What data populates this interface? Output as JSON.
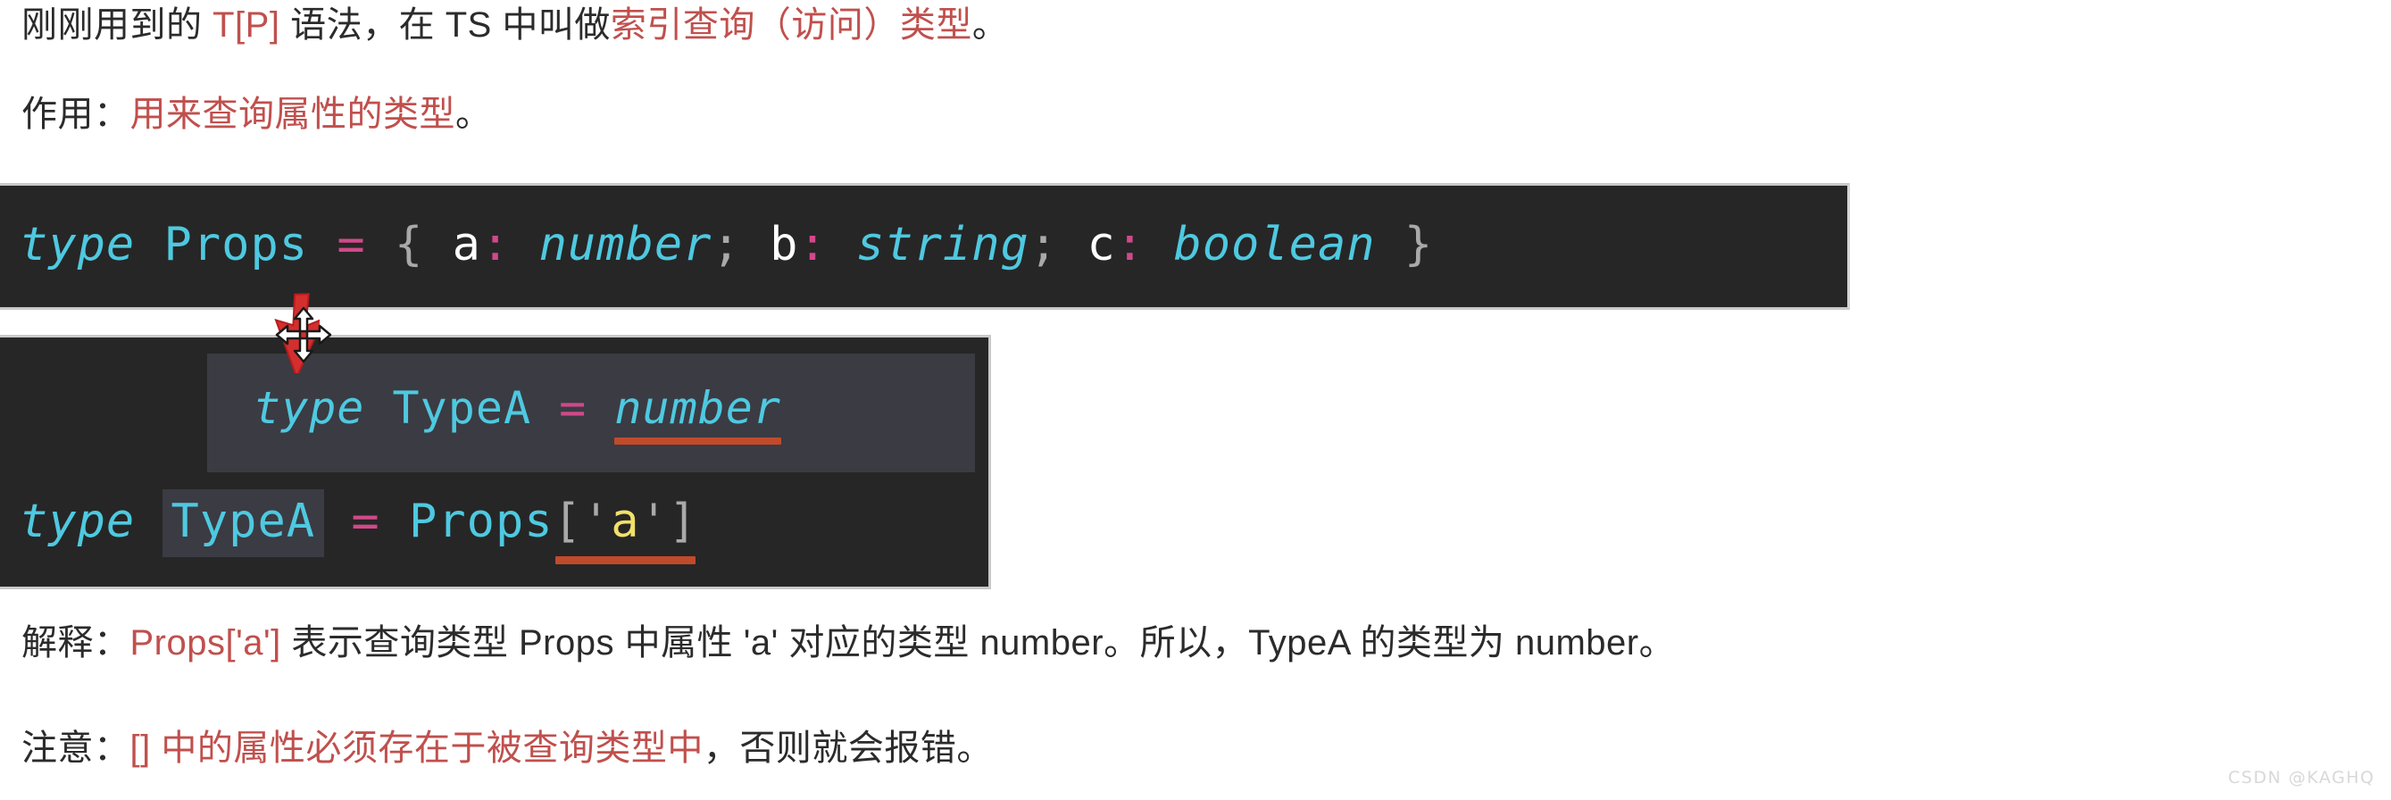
{
  "paragraphs": {
    "intro": {
      "lead": "刚刚用到的 ",
      "code": "T[P]",
      "mid": " 语法，在 TS 中叫做",
      "highlight": "索引查询（访问）类型",
      "tail": "。"
    },
    "usage": {
      "lead": "作用：",
      "highlight": "用来查询属性的类型",
      "tail": "。"
    },
    "explain": {
      "lead": "解释：",
      "highlight": "Props['a']",
      "tail": " 表示查询类型 Props 中属性 'a' 对应的类型 number。所以，TypeA 的类型为 number。"
    },
    "note": {
      "lead": "注意：",
      "highlight": "[] 中的属性必须存在于被查询类型中",
      "tail": "，否则就会报错。"
    }
  },
  "code_block_props": {
    "tokens": {
      "kw_type": "type",
      "space1": " ",
      "name_props": "Props",
      "space2": " ",
      "eq": "=",
      "space3": " ",
      "brace_open": "{",
      "space4": " ",
      "prop_a": "a",
      "colon_a": ":",
      "space5": " ",
      "type_number": "number",
      "semi1": ";",
      "space6": " ",
      "prop_b": "b",
      "colon_b": ":",
      "space7": " ",
      "type_string": "string",
      "semi2": ";",
      "space8": " ",
      "prop_c": "c",
      "colon_c": ":",
      "space9": " ",
      "type_boolean": "boolean",
      "space10": " ",
      "brace_close": "}"
    }
  },
  "code_block_typea": {
    "tooltip": {
      "kw_type": "type",
      "space1": " ",
      "name": "TypeA",
      "space2": " ",
      "eq": "=",
      "space3": " ",
      "resolved_type": "number"
    },
    "line": {
      "kw_type": "type",
      "space1": " ",
      "name": "TypeA",
      "space2": " ",
      "eq": "=",
      "space3": " ",
      "source_type": "Props",
      "bracket_open": "[",
      "quote_open": "'",
      "key": "a",
      "quote_close": "'",
      "bracket_close": "]"
    }
  },
  "watermark": "CSDN @KAGHQ",
  "colors": {
    "page_background": "#ffffff",
    "code_background": "#262626",
    "tooltip_background": "#3b3b43",
    "keyword_cyan": "#4ec9e0",
    "operator_pink": "#d1498a",
    "punctuation_gray": "#a9a9a9",
    "property_white": "#ffffff",
    "string_yellow": "#f2e06a",
    "underline_orange": "#c14a2b",
    "prose_red": "#c0504d",
    "prose_dark": "#2b2b2b",
    "cursor_red": "#d32f2f"
  }
}
